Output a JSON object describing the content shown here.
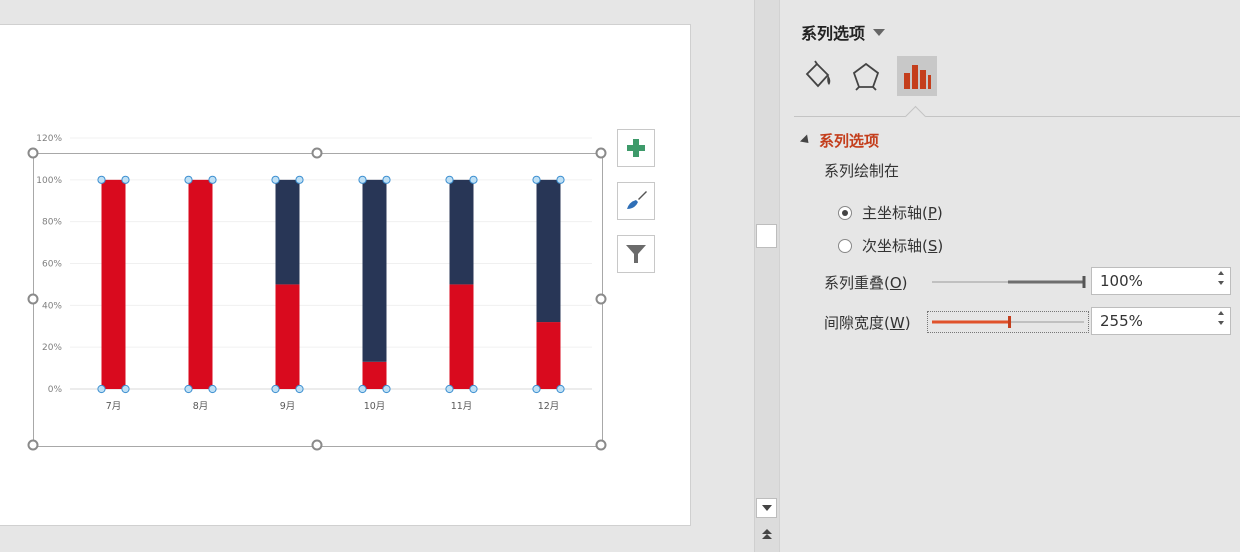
{
  "chart_data": {
    "type": "bar",
    "stacked": true,
    "categories": [
      "7月",
      "8月",
      "9月",
      "10月",
      "11月",
      "12月"
    ],
    "series": [
      {
        "color": "#d90a1e",
        "values": [
          100,
          100,
          50,
          13,
          50,
          32
        ]
      },
      {
        "color": "#283656",
        "values": [
          0,
          0,
          50,
          87,
          50,
          68
        ]
      }
    ],
    "yticks": [
      "0%",
      "20%",
      "40%",
      "60%",
      "80%",
      "100%",
      "120%"
    ],
    "ylim": [
      0,
      120
    ],
    "grid": true
  },
  "chart_buttons": {
    "add_icon": "plus-icon",
    "style_icon": "paintbrush-icon",
    "filter_icon": "funnel-icon"
  },
  "pane": {
    "title": "系列选项",
    "tabs": [
      "fill-line-icon",
      "effects-pentagon-icon",
      "series-options-icon"
    ],
    "section": "系列选项",
    "plot_on_label": "系列绘制在",
    "primary_axis": {
      "text": "主坐标轴(",
      "key": "P",
      "close": ")",
      "checked": true
    },
    "secondary_axis": {
      "text": "次坐标轴(",
      "key": "S",
      "close": ")",
      "checked": false
    },
    "overlap": {
      "text": "系列重叠(",
      "key": "O",
      "close": ")",
      "value": "100%",
      "level": 100
    },
    "gap": {
      "text": "间隙宽度(",
      "key": "W",
      "close": ")",
      "value": "255%",
      "level": 51
    }
  },
  "colors": {
    "accent": "#c43e1c",
    "slider_active": "#e0522b"
  }
}
